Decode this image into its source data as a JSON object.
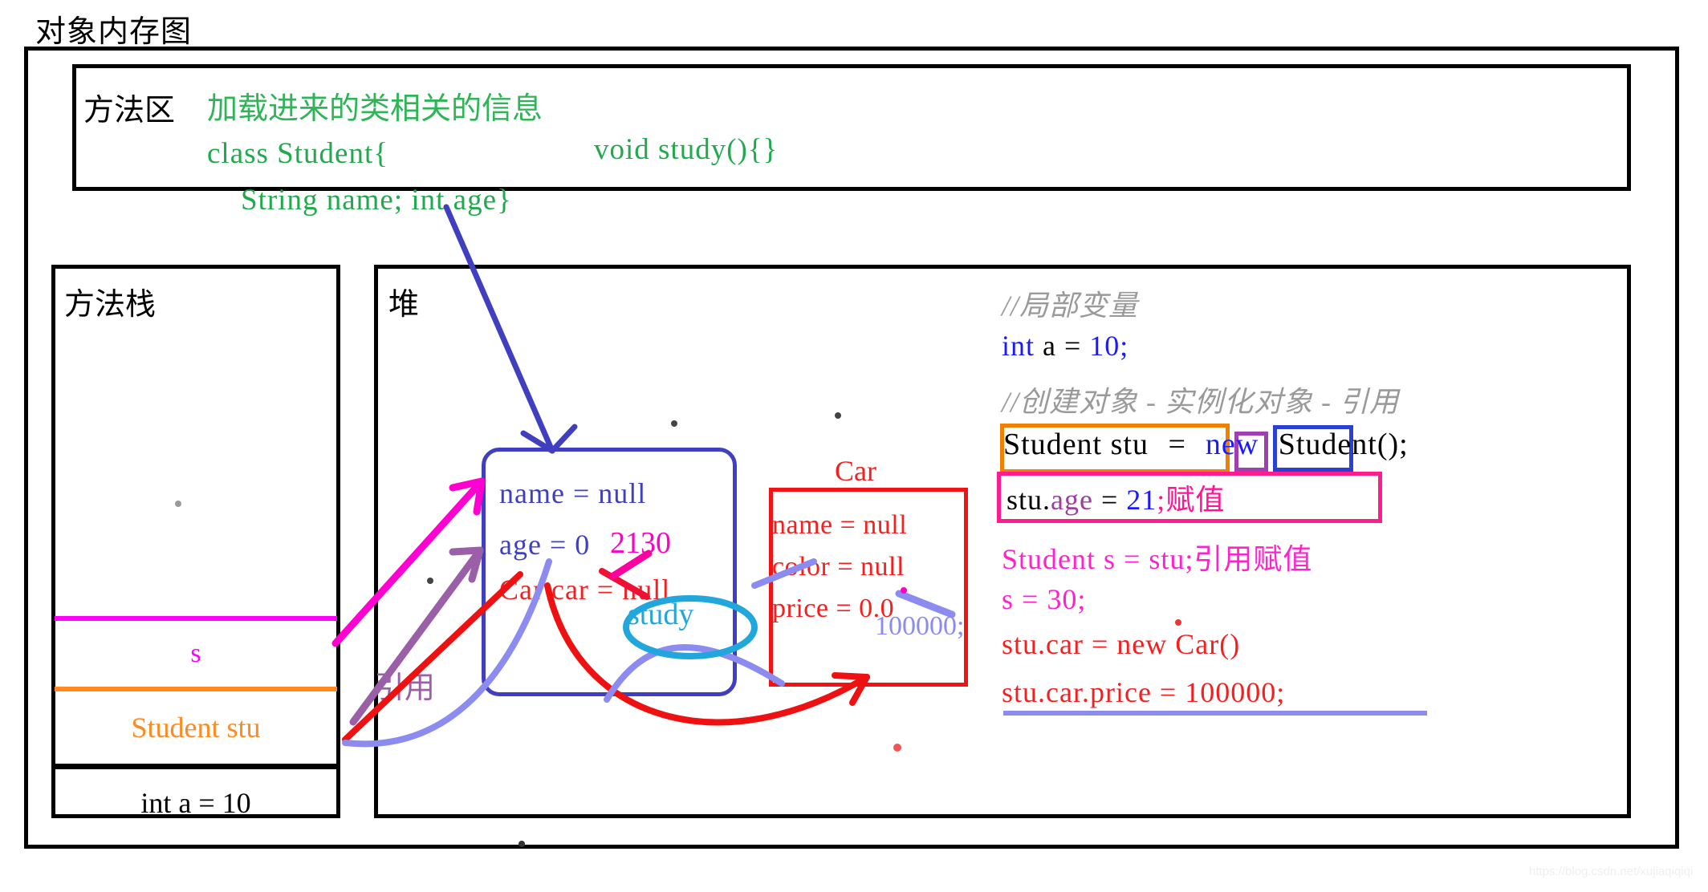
{
  "page": {
    "title": "对象内存图",
    "watermark": "https://blog.csdn.net/xujiaqiqiqi"
  },
  "method_area": {
    "label": "方法区",
    "note": "加载进来的类相关的信息",
    "code_line_1": "class Student{",
    "code_line_2": "String name; int age}",
    "code_line_3": "void study(){}"
  },
  "stack": {
    "label": "方法栈",
    "slots": [
      {
        "name": "s-slot",
        "text": "s",
        "color": "#ff00ff"
      },
      {
        "name": "stu-slot",
        "text": "Student stu",
        "color": "#ff8a20"
      },
      {
        "name": "int-a-slot",
        "text": "int a = 10",
        "color": "#000000"
      }
    ]
  },
  "heap": {
    "label": "堆",
    "student_object": {
      "field_name": "name = null",
      "field_age": "age = 0",
      "field_age_overwrite_1": "21",
      "field_age_overwrite_2": "30",
      "field_car": "Car car = null",
      "method": "study"
    },
    "car_object": {
      "title": "Car",
      "field_name": "name = null",
      "field_color": "color = null",
      "field_price": "price = 0.0",
      "field_price_overwrite": "100000;"
    },
    "annotation_reference": "引用"
  },
  "code": {
    "comment_local_var": "//局部变量",
    "int_a": {
      "kw": "int",
      "mid": " a = ",
      "val": "10",
      "end": ";"
    },
    "comment_create_object": "//创建对象 - 实例化对象 - 引用",
    "new_student": {
      "decl": "Student stu ",
      "eq": "=",
      "kw_new": "new",
      "tail": " Student();"
    },
    "stu_age": {
      "obj": "stu.",
      "field": "age",
      "eq": " = ",
      "val": "21",
      "semi": ";",
      "note": "赋值"
    },
    "student_s": "Student s = stu;引用赋值",
    "s_30": "s = 30;",
    "stu_car": "stu.car = new Car()",
    "stu_car_price": "stu.car.price = 100000;"
  },
  "colors": {
    "green": "#22a94e",
    "blue": "#3f3fc0",
    "red": "#f42020",
    "magenta": "#ff00ff",
    "pink": "#ff1c8e",
    "orange": "#ff8a20",
    "purple": "#9b5fa8",
    "cyan": "#22a7dd",
    "periwinkle": "#8c8cf0",
    "gray": "#9a9a9a",
    "keyword_blue": "#1a1aff"
  }
}
